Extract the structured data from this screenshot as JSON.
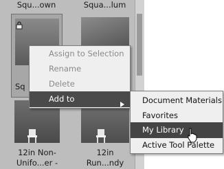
{
  "tiles": {
    "top_left_label": "Squ...own",
    "top_right_label": "Squa...lum",
    "selected_label": "Sq",
    "bottom_left_label_1": "12in Non-",
    "bottom_left_label_2": "Unifo...er -",
    "bottom_right_label_1": "12in",
    "bottom_right_label_2": "Run...ndy"
  },
  "context_menu": {
    "items": [
      {
        "label": "Assign to Selection",
        "state": "disabled"
      },
      {
        "label": "Rename",
        "state": "disabled"
      },
      {
        "label": "Delete",
        "state": "disabled"
      },
      {
        "label": "Add to",
        "state": "active"
      }
    ]
  },
  "submenu": {
    "items": [
      {
        "label": "Document Materials",
        "state": "normal"
      },
      {
        "label": "Favorites",
        "state": "normal"
      },
      {
        "label": "My Library",
        "state": "active"
      },
      {
        "label": "Active Tool Palette",
        "state": "normal"
      }
    ]
  },
  "icons": [
    "lock-icon",
    "submenu-arrow-icon",
    "cursor-pointer-icon",
    "chair-icon"
  ],
  "colors": {
    "menu_background": "#efefef",
    "highlight": "#4a4a4a",
    "panel": "#bdbdbd"
  }
}
